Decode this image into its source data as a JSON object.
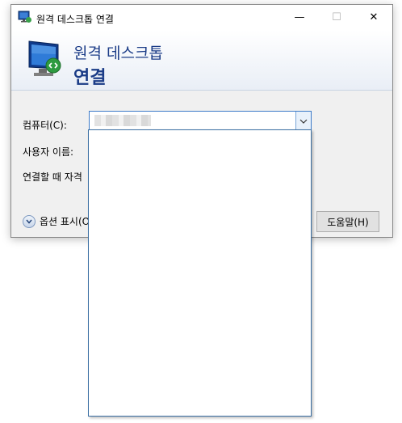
{
  "window": {
    "title": "원격 데스크톱 연결",
    "minimize_glyph": "—",
    "maximize_glyph": "☐",
    "close_glyph": "✕"
  },
  "banner": {
    "line1": "원격 데스크톱",
    "line2": "연결"
  },
  "form": {
    "computer_label": "컴퓨터(C):",
    "computer_value": "",
    "user_label": "사용자 이름:",
    "credentials_label": "연결할 때 자격"
  },
  "footer": {
    "options_label": "옵션 표시(O)",
    "help_label": "도움말(H)"
  },
  "dropdown": {
    "items": []
  },
  "colors": {
    "accent": "#1b3c87",
    "focus_border": "#3d7bc8"
  },
  "icons": {
    "app": "remote-desktop-icon",
    "options": "chevron-down-circle-icon"
  }
}
